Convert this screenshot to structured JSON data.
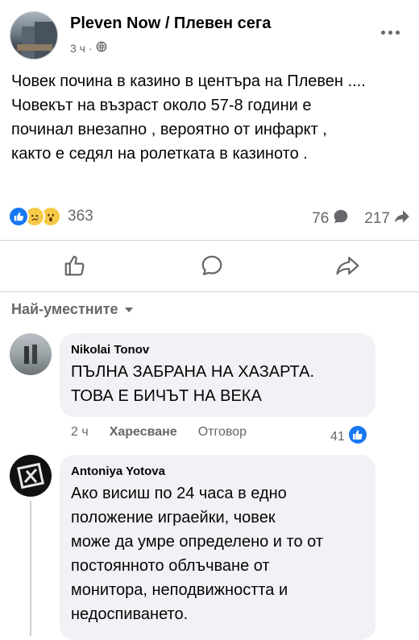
{
  "post": {
    "page_name": "Pleven Now / Плевен сега",
    "time": "3 ч",
    "separator": "·",
    "text_lines": [
      "Човек почина в казино в центъра на Плевен ....",
      "Човекът на възраст около 57-8 години е",
      "починал внезапно , вероятно от инфаркт ,",
      "както е седял на ролетката в казиното ."
    ],
    "reaction_icons": [
      "like-icon",
      "sad-icon",
      "wow-icon"
    ],
    "reactions_count": "363",
    "comments_count": "76",
    "shares_count": "217"
  },
  "actions": {
    "icons": [
      "thumbs-up-icon",
      "comment-icon",
      "share-icon"
    ]
  },
  "comments_sort": {
    "label": "Най-уместните"
  },
  "comments": [
    {
      "author": "Nikolai Tonov",
      "text_lines": [
        "ПЪЛНА ЗАБРАНА НА ХАЗАРТА.",
        "ТОВА Е БИЧЪТ НА ВЕКА"
      ],
      "time": "2 ч",
      "like_label": "Харесване",
      "reply_label": "Отговор",
      "likes": "41"
    },
    {
      "author": "Antoniya Yotova",
      "text_lines": [
        "Ако висиш по 24 часа в едно",
        "положение играейки, човек",
        "може да умре определено и то от",
        "постоянното облъчване от",
        "монитора, неподвижността и",
        "недоспиването."
      ]
    }
  ],
  "colors": {
    "brand_blue": "#1877f2",
    "secondary_text": "#65676b",
    "bubble_bg": "#f0f2f5",
    "divider": "#ced0d4"
  }
}
